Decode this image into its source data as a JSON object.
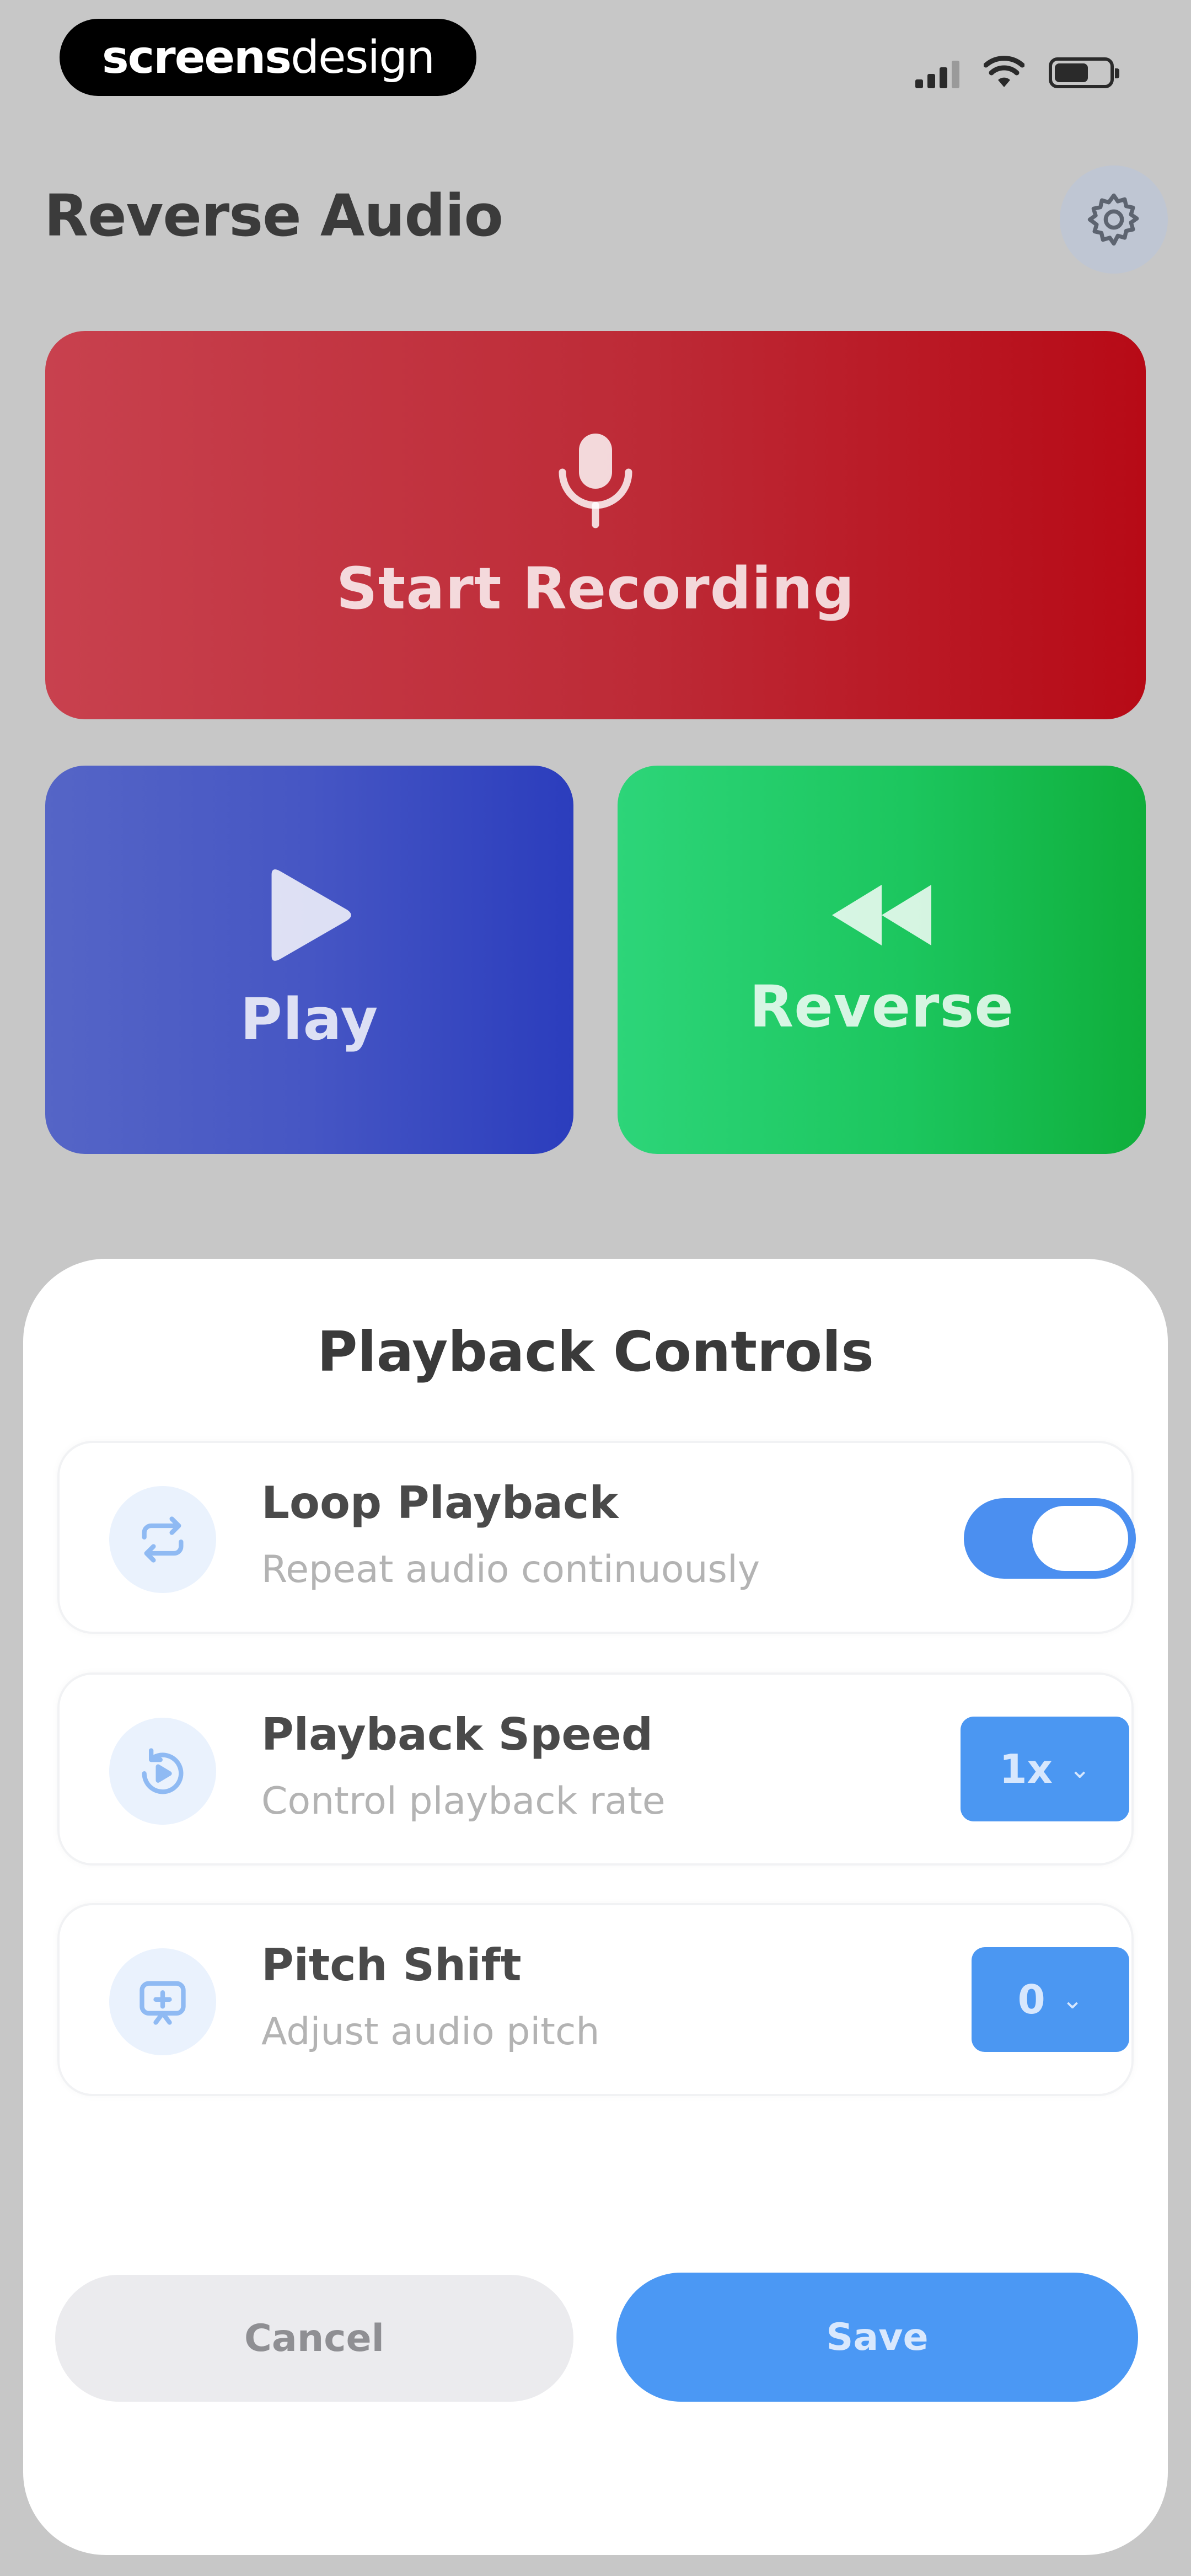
{
  "status_bar": {
    "brand_bold": "screens",
    "brand_light": "design",
    "signal_icon": "signal-icon",
    "wifi_icon": "wifi-icon",
    "battery_icon": "battery-icon"
  },
  "header": {
    "title": "Reverse Audio",
    "settings_icon": "gear-icon"
  },
  "actions": {
    "record": {
      "label": "Start Recording",
      "icon": "microphone-icon",
      "color": "#bd2a36"
    },
    "play": {
      "label": "Play",
      "icon": "play-icon",
      "color": "#4656c4"
    },
    "reverse": {
      "label": "Reverse",
      "icon": "rewind-icon",
      "color": "#1cc65e"
    }
  },
  "sheet": {
    "title": "Playback Controls",
    "rows": [
      {
        "title": "Loop Playback",
        "subtitle": "Repeat audio continuously",
        "icon": "repeat-icon",
        "control": "toggle",
        "enabled": true
      },
      {
        "title": "Playback Speed",
        "subtitle": "Control playback rate",
        "icon": "speed-icon",
        "control": "select",
        "value": "1x"
      },
      {
        "title": "Pitch Shift",
        "subtitle": "Adjust audio pitch",
        "icon": "pitch-icon",
        "control": "select",
        "value": "0"
      }
    ],
    "cancel_label": "Cancel",
    "save_label": "Save",
    "accent_color": "#4b98f4"
  }
}
